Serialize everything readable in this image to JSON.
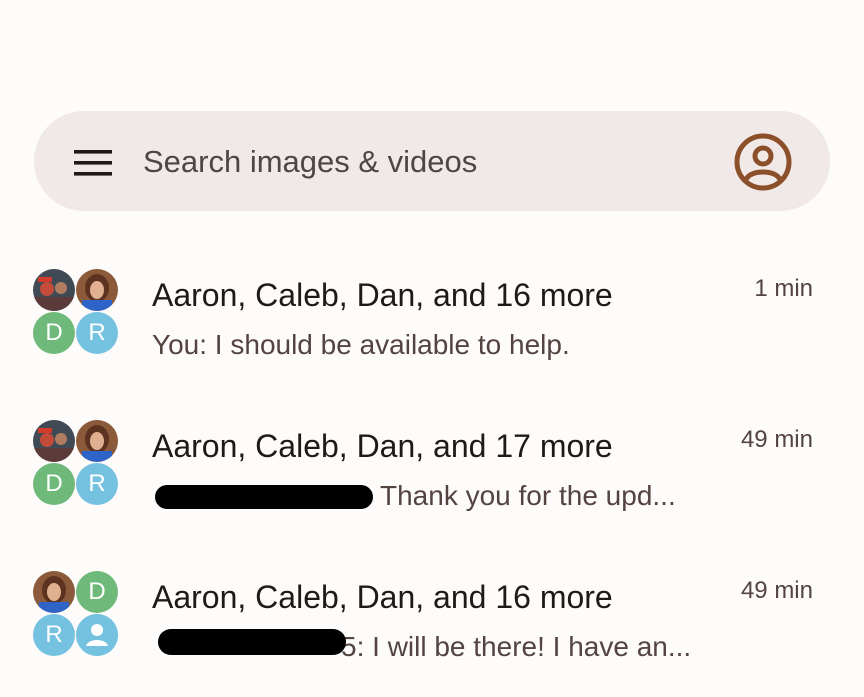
{
  "search": {
    "placeholder": "Search images & videos"
  },
  "conversations": [
    {
      "title": "Aaron, Caleb, Dan, and 16 more",
      "snippet": "You: I should be available to help.",
      "time": "1 min",
      "avatars": [
        "photo",
        "photo",
        "D",
        "R"
      ]
    },
    {
      "title": "Aaron, Caleb, Dan, and 17 more",
      "snippet_visible": "Thank you for the upd...",
      "time": "49 min",
      "avatars": [
        "photo",
        "photo",
        "D",
        "R"
      ]
    },
    {
      "title": "Aaron, Caleb, Dan, and 16 more",
      "snippet_visible": "5: I will be there! I have an...",
      "time": "49 min",
      "avatars": [
        "photo",
        "D",
        "R",
        "person"
      ]
    }
  ],
  "colors": {
    "background": "#fefbfb",
    "search_bar": "#f1e9e7",
    "accent": "#8b4f2a",
    "avatar_green": "#6fb97a",
    "avatar_blue": "#74c2e0"
  }
}
